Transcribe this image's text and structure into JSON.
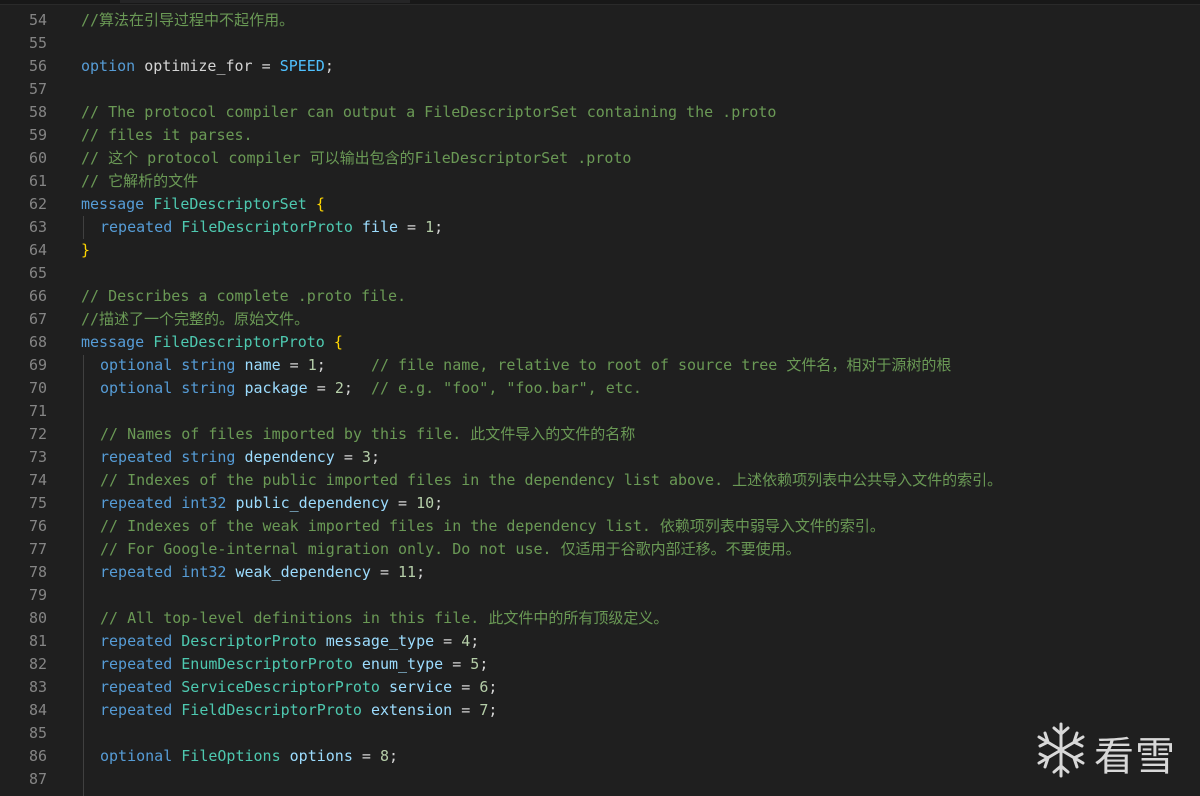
{
  "editor": {
    "lines": [
      {
        "n": "54",
        "tokens": [
          {
            "t": "cm",
            "v": "//算法在引导过程中不起作用。"
          }
        ]
      },
      {
        "n": "55",
        "tokens": []
      },
      {
        "n": "56",
        "tokens": [
          {
            "t": "kw",
            "v": "option"
          },
          {
            "t": "pl",
            "v": " optimize_for = "
          },
          {
            "t": "cn",
            "v": "SPEED"
          },
          {
            "t": "pl",
            "v": ";"
          }
        ]
      },
      {
        "n": "57",
        "tokens": []
      },
      {
        "n": "58",
        "tokens": [
          {
            "t": "cm",
            "v": "// The protocol compiler can output a FileDescriptorSet containing the .proto"
          }
        ]
      },
      {
        "n": "59",
        "tokens": [
          {
            "t": "cm",
            "v": "// files it parses."
          }
        ]
      },
      {
        "n": "60",
        "tokens": [
          {
            "t": "cm",
            "v": "// 这个 protocol compiler 可以输出包含的FileDescriptorSet .proto"
          }
        ]
      },
      {
        "n": "61",
        "tokens": [
          {
            "t": "cm",
            "v": "// 它解析的文件"
          }
        ]
      },
      {
        "n": "62",
        "tokens": [
          {
            "t": "kw",
            "v": "message"
          },
          {
            "t": "pl",
            "v": " "
          },
          {
            "t": "ty",
            "v": "FileDescriptorSet"
          },
          {
            "t": "pl",
            "v": " "
          },
          {
            "t": "br",
            "v": "{"
          }
        ]
      },
      {
        "n": "63",
        "indent": true,
        "tokens": [
          {
            "t": "kw",
            "v": "repeated"
          },
          {
            "t": "pl",
            "v": " "
          },
          {
            "t": "ty",
            "v": "FileDescriptorProto"
          },
          {
            "t": "pl",
            "v": " "
          },
          {
            "t": "id",
            "v": "file"
          },
          {
            "t": "pl",
            "v": " = "
          },
          {
            "t": "nm",
            "v": "1"
          },
          {
            "t": "pl",
            "v": ";"
          }
        ]
      },
      {
        "n": "64",
        "tokens": [
          {
            "t": "br",
            "v": "}"
          }
        ]
      },
      {
        "n": "65",
        "tokens": []
      },
      {
        "n": "66",
        "tokens": [
          {
            "t": "cm",
            "v": "// Describes a complete .proto file."
          }
        ]
      },
      {
        "n": "67",
        "tokens": [
          {
            "t": "cm",
            "v": "//描述了一个完整的。原始文件。"
          }
        ]
      },
      {
        "n": "68",
        "tokens": [
          {
            "t": "kw",
            "v": "message"
          },
          {
            "t": "pl",
            "v": " "
          },
          {
            "t": "ty",
            "v": "FileDescriptorProto"
          },
          {
            "t": "pl",
            "v": " "
          },
          {
            "t": "br",
            "v": "{"
          }
        ]
      },
      {
        "n": "69",
        "indent": true,
        "tokens": [
          {
            "t": "kw",
            "v": "optional"
          },
          {
            "t": "pl",
            "v": " "
          },
          {
            "t": "kw",
            "v": "string"
          },
          {
            "t": "pl",
            "v": " "
          },
          {
            "t": "id",
            "v": "name"
          },
          {
            "t": "pl",
            "v": " = "
          },
          {
            "t": "nm",
            "v": "1"
          },
          {
            "t": "pl",
            "v": ";     "
          },
          {
            "t": "cm",
            "v": "// file name, relative to root of source tree 文件名，相对于源树的根"
          }
        ]
      },
      {
        "n": "70",
        "indent": true,
        "tokens": [
          {
            "t": "kw",
            "v": "optional"
          },
          {
            "t": "pl",
            "v": " "
          },
          {
            "t": "kw",
            "v": "string"
          },
          {
            "t": "pl",
            "v": " "
          },
          {
            "t": "id",
            "v": "package"
          },
          {
            "t": "pl",
            "v": " = "
          },
          {
            "t": "nm",
            "v": "2"
          },
          {
            "t": "pl",
            "v": ";  "
          },
          {
            "t": "cm",
            "v": "// e.g. \"foo\", \"foo.bar\", etc."
          }
        ]
      },
      {
        "n": "71",
        "indent": true,
        "tokens": []
      },
      {
        "n": "72",
        "indent": true,
        "tokens": [
          {
            "t": "cm",
            "v": "// Names of files imported by this file. 此文件导入的文件的名称"
          }
        ]
      },
      {
        "n": "73",
        "indent": true,
        "tokens": [
          {
            "t": "kw",
            "v": "repeated"
          },
          {
            "t": "pl",
            "v": " "
          },
          {
            "t": "kw",
            "v": "string"
          },
          {
            "t": "pl",
            "v": " "
          },
          {
            "t": "id",
            "v": "dependency"
          },
          {
            "t": "pl",
            "v": " = "
          },
          {
            "t": "nm",
            "v": "3"
          },
          {
            "t": "pl",
            "v": ";"
          }
        ]
      },
      {
        "n": "74",
        "indent": true,
        "tokens": [
          {
            "t": "cm",
            "v": "// Indexes of the public imported files in the dependency list above. 上述依赖项列表中公共导入文件的索引。"
          }
        ]
      },
      {
        "n": "75",
        "indent": true,
        "tokens": [
          {
            "t": "kw",
            "v": "repeated"
          },
          {
            "t": "pl",
            "v": " "
          },
          {
            "t": "kw",
            "v": "int32"
          },
          {
            "t": "pl",
            "v": " "
          },
          {
            "t": "id",
            "v": "public_dependency"
          },
          {
            "t": "pl",
            "v": " = "
          },
          {
            "t": "nm",
            "v": "10"
          },
          {
            "t": "pl",
            "v": ";"
          }
        ]
      },
      {
        "n": "76",
        "indent": true,
        "tokens": [
          {
            "t": "cm",
            "v": "// Indexes of the weak imported files in the dependency list. 依赖项列表中弱导入文件的索引。"
          }
        ]
      },
      {
        "n": "77",
        "indent": true,
        "tokens": [
          {
            "t": "cm",
            "v": "// For Google-internal migration only. Do not use. 仅适用于谷歌内部迁移。不要使用。"
          }
        ]
      },
      {
        "n": "78",
        "indent": true,
        "tokens": [
          {
            "t": "kw",
            "v": "repeated"
          },
          {
            "t": "pl",
            "v": " "
          },
          {
            "t": "kw",
            "v": "int32"
          },
          {
            "t": "pl",
            "v": " "
          },
          {
            "t": "id",
            "v": "weak_dependency"
          },
          {
            "t": "pl",
            "v": " = "
          },
          {
            "t": "nm",
            "v": "11"
          },
          {
            "t": "pl",
            "v": ";"
          }
        ]
      },
      {
        "n": "79",
        "indent": true,
        "tokens": []
      },
      {
        "n": "80",
        "indent": true,
        "tokens": [
          {
            "t": "cm",
            "v": "// All top-level definitions in this file. 此文件中的所有顶级定义。"
          }
        ]
      },
      {
        "n": "81",
        "indent": true,
        "tokens": [
          {
            "t": "kw",
            "v": "repeated"
          },
          {
            "t": "pl",
            "v": " "
          },
          {
            "t": "ty",
            "v": "DescriptorProto"
          },
          {
            "t": "pl",
            "v": " "
          },
          {
            "t": "id",
            "v": "message_type"
          },
          {
            "t": "pl",
            "v": " = "
          },
          {
            "t": "nm",
            "v": "4"
          },
          {
            "t": "pl",
            "v": ";"
          }
        ]
      },
      {
        "n": "82",
        "indent": true,
        "tokens": [
          {
            "t": "kw",
            "v": "repeated"
          },
          {
            "t": "pl",
            "v": " "
          },
          {
            "t": "ty",
            "v": "EnumDescriptorProto"
          },
          {
            "t": "pl",
            "v": " "
          },
          {
            "t": "id",
            "v": "enum_type"
          },
          {
            "t": "pl",
            "v": " = "
          },
          {
            "t": "nm",
            "v": "5"
          },
          {
            "t": "pl",
            "v": ";"
          }
        ]
      },
      {
        "n": "83",
        "indent": true,
        "tokens": [
          {
            "t": "kw",
            "v": "repeated"
          },
          {
            "t": "pl",
            "v": " "
          },
          {
            "t": "ty",
            "v": "ServiceDescriptorProto"
          },
          {
            "t": "pl",
            "v": " "
          },
          {
            "t": "id",
            "v": "service"
          },
          {
            "t": "pl",
            "v": " = "
          },
          {
            "t": "nm",
            "v": "6"
          },
          {
            "t": "pl",
            "v": ";"
          }
        ]
      },
      {
        "n": "84",
        "indent": true,
        "tokens": [
          {
            "t": "kw",
            "v": "repeated"
          },
          {
            "t": "pl",
            "v": " "
          },
          {
            "t": "ty",
            "v": "FieldDescriptorProto"
          },
          {
            "t": "pl",
            "v": " "
          },
          {
            "t": "id",
            "v": "extension"
          },
          {
            "t": "pl",
            "v": " = "
          },
          {
            "t": "nm",
            "v": "7"
          },
          {
            "t": "pl",
            "v": ";"
          }
        ]
      },
      {
        "n": "85",
        "indent": true,
        "tokens": []
      },
      {
        "n": "86",
        "indent": true,
        "tokens": [
          {
            "t": "kw",
            "v": "optional"
          },
          {
            "t": "pl",
            "v": " "
          },
          {
            "t": "ty",
            "v": "FileOptions"
          },
          {
            "t": "pl",
            "v": " "
          },
          {
            "t": "id",
            "v": "options"
          },
          {
            "t": "pl",
            "v": " = "
          },
          {
            "t": "nm",
            "v": "8"
          },
          {
            "t": "pl",
            "v": ";"
          }
        ]
      },
      {
        "n": "87",
        "indent": true,
        "tokens": []
      }
    ]
  },
  "watermark": {
    "text": "看雪",
    "icon": "snowflake-icon"
  },
  "colors": {
    "background": "#1f1f1f",
    "keyword": "#569cd6",
    "type": "#4ec9b0",
    "identifier": "#9cdcfe",
    "comment": "#6a9955",
    "number": "#b5cea8",
    "bracket": "#ffd700",
    "constant": "#4fc1ff",
    "line_number": "#858585"
  }
}
